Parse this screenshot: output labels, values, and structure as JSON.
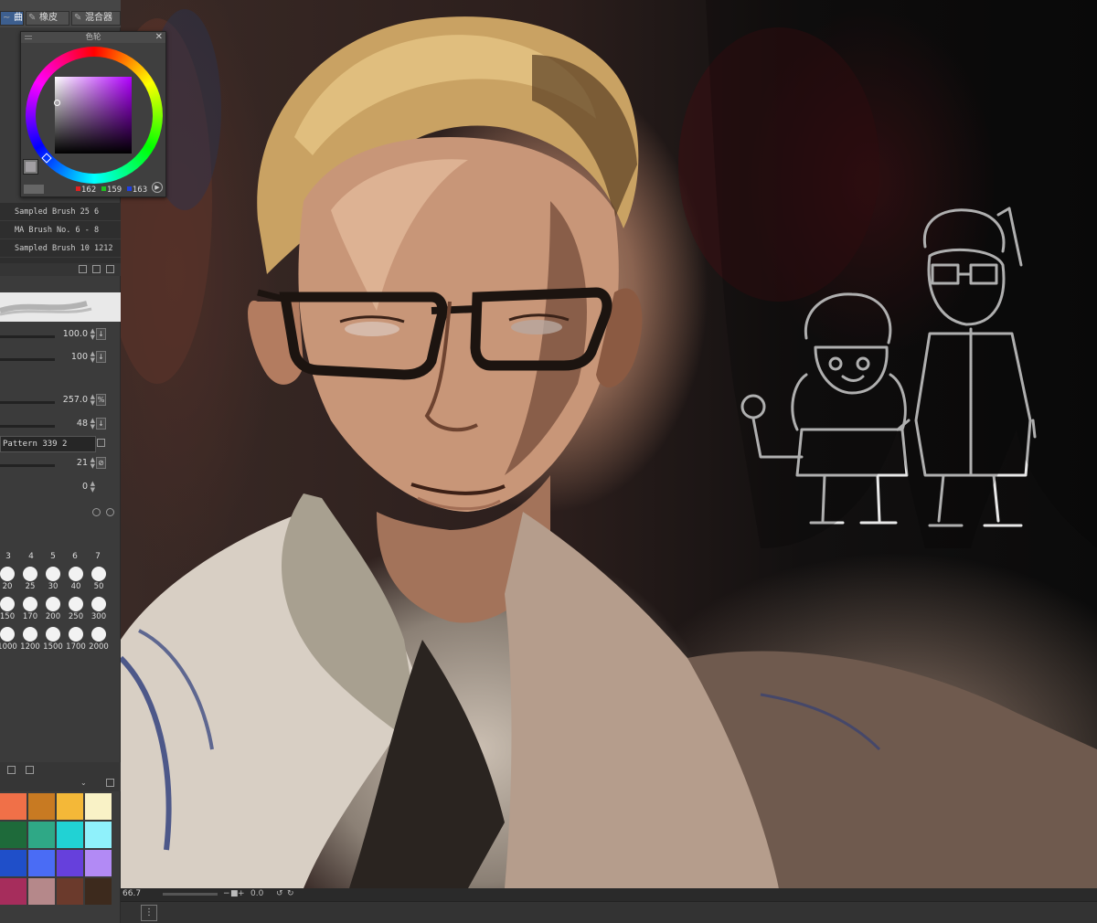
{
  "tool_tabs": [
    {
      "label": "曲画",
      "icon": "curve-icon",
      "active": true
    },
    {
      "label": "橡皮",
      "icon": "eraser-icon",
      "active": false
    },
    {
      "label": "混合器",
      "icon": "blend-icon",
      "active": false
    }
  ],
  "color_wheel": {
    "title": "色轮",
    "close_glyph": "✕",
    "current_color": "#a29fa3",
    "rgb": {
      "r": "162",
      "g": "159",
      "b": "163"
    }
  },
  "brush_list": [
    "Sampled Brush 25 6",
    "MA Brush No.  6 - 8",
    "Sampled Brush 10 1212"
  ],
  "properties": [
    {
      "value": "100.0",
      "btn": "↓"
    },
    {
      "value": "100",
      "btn": "↓"
    },
    {
      "value": "257.0",
      "btn": "%"
    },
    {
      "value": "48",
      "btn": "↓"
    },
    {
      "value": "21",
      "btn": "⊘"
    },
    {
      "value": "0",
      "btn": ""
    }
  ],
  "texture_pattern": "Pattern 339 2",
  "brush_sizes": {
    "header": [
      "3",
      "4",
      "5",
      "6",
      "7"
    ],
    "rows": [
      [
        "20",
        "25",
        "30",
        "40",
        "50"
      ],
      [
        "150",
        "170",
        "200",
        "250",
        "300"
      ],
      [
        "1000",
        "1200",
        "1500",
        "1700",
        "2000"
      ]
    ]
  },
  "palette": [
    [
      "#f07048",
      "#c87a22",
      "#f4b838",
      "#f9f2c6"
    ],
    [
      "#1e6a3a",
      "#2fa886",
      "#21d2d4",
      "#8ff1fb"
    ],
    [
      "#1f4fc9",
      "#4a6cf5",
      "#6640dc",
      "#b28af5"
    ],
    [
      "#a62d5c",
      "#b5888a",
      "#6b3a2c",
      "#3d2a1d"
    ]
  ],
  "status": {
    "zoom": "66.7",
    "angle": "0.0"
  }
}
